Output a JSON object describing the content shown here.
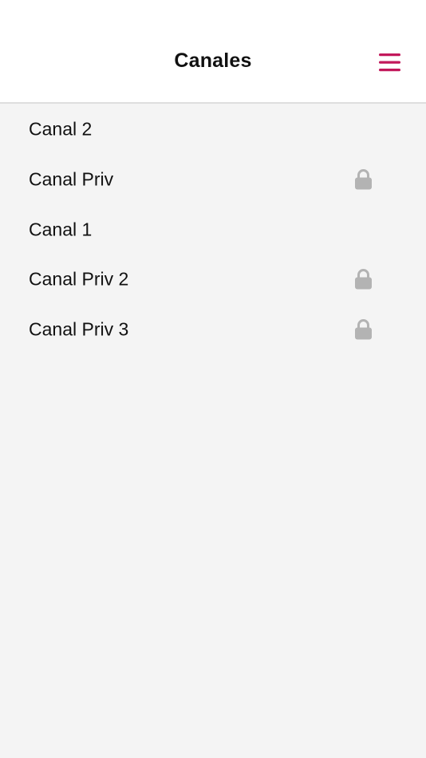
{
  "header": {
    "title": "Canales",
    "accent_color": "#c2185b",
    "menu_icon": "hamburger-menu-icon"
  },
  "channels": [
    {
      "name": "Canal 2",
      "locked": false
    },
    {
      "name": "Canal Priv",
      "locked": true
    },
    {
      "name": "Canal 1",
      "locked": false
    },
    {
      "name": "Canal Priv 2",
      "locked": true
    },
    {
      "name": "Canal Priv 3",
      "locked": true
    }
  ],
  "colors": {
    "background": "#f4f4f4",
    "header_bg": "#ffffff",
    "lock_icon": "#b3b3b3"
  }
}
